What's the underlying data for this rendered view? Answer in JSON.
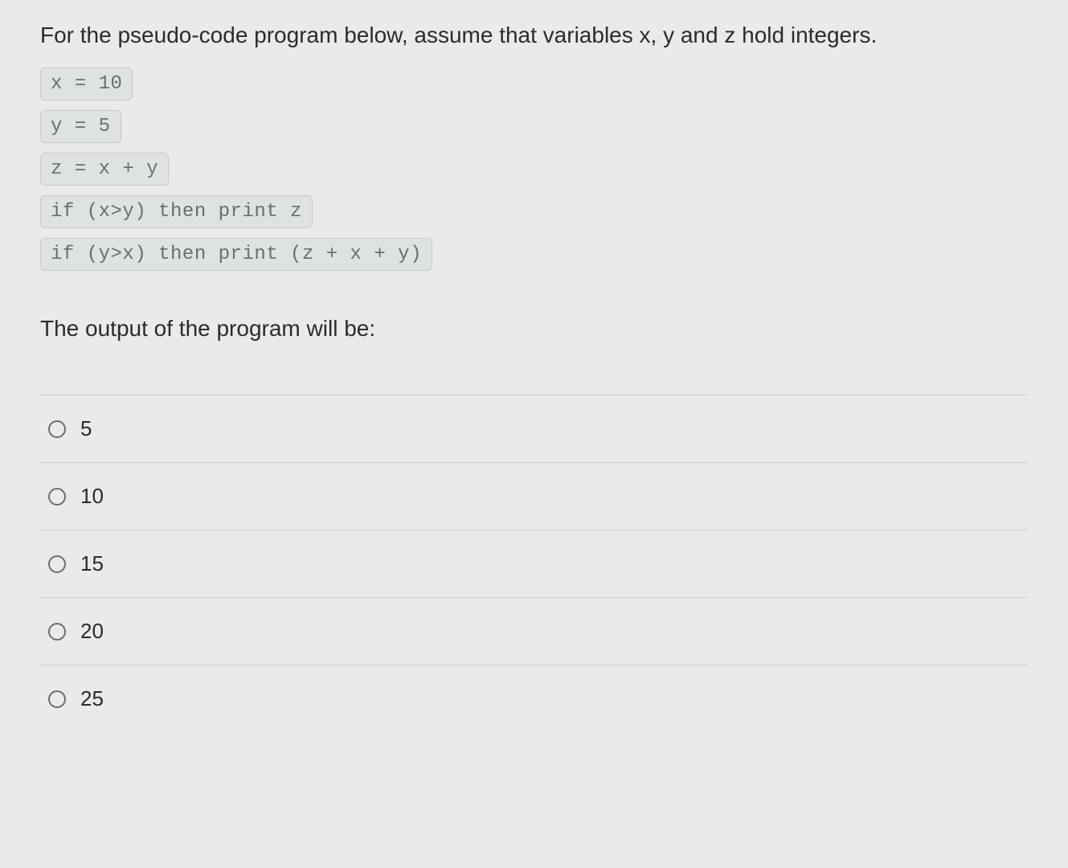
{
  "question": {
    "intro": "For the pseudo-code program below, assume that variables x, y and z hold integers.",
    "code": [
      "x = 10",
      "y = 5",
      "z = x + y",
      "if (x>y) then print z",
      "if (y>x) then print (z + x + y)"
    ],
    "prompt": "The output of the program will be:"
  },
  "options": [
    {
      "label": "5"
    },
    {
      "label": "10"
    },
    {
      "label": "15"
    },
    {
      "label": "20"
    },
    {
      "label": "25"
    }
  ]
}
